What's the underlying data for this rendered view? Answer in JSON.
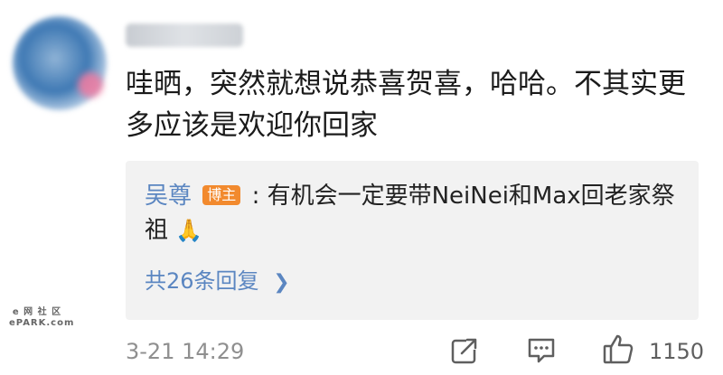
{
  "comment": {
    "username": "",
    "text": "哇晒，突然就想说恭喜贺喜，哈哈。不其实更多应该是欢迎你回家",
    "timestamp": "3-21 14:29",
    "like_count": "1150"
  },
  "reply": {
    "author": "吴尊",
    "badge": "博主",
    "separator": ":",
    "text": " 有机会一定要带NeiNei和Max回老家祭祖",
    "emoji": "🙏",
    "more_replies": "共26条回复"
  },
  "watermark": {
    "line1": "e 网 社 区",
    "line2": "ePARK.com"
  },
  "icons": {
    "share": "share-icon",
    "comment": "comment-icon",
    "like": "thumbs-up-icon",
    "chevron": "chevron-right-icon"
  },
  "colors": {
    "link_blue": "#5b86c1",
    "badge_orange": "#f28a2e",
    "reply_bg": "#f2f2f2",
    "meta_gray": "#8f8f8f"
  }
}
